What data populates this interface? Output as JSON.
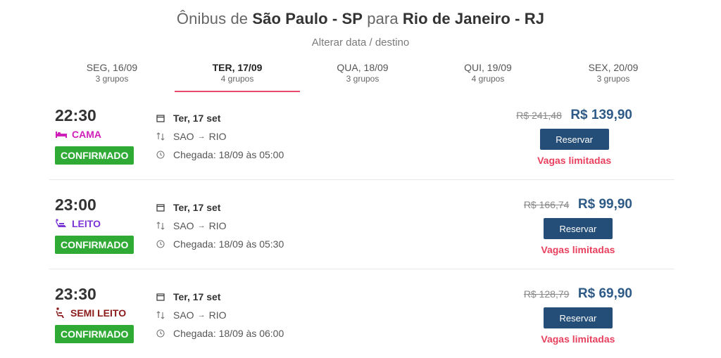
{
  "header": {
    "prefix": "Ônibus de",
    "origin": "São Paulo - SP",
    "middle": "para",
    "destination": "Rio de Janeiro - RJ",
    "change_link": "Alterar data / destino"
  },
  "tabs": [
    {
      "date": "SEG, 16/09",
      "groups": "3 grupos",
      "active": false
    },
    {
      "date": "TER, 17/09",
      "groups": "4 grupos",
      "active": true
    },
    {
      "date": "QUA, 18/09",
      "groups": "3 grupos",
      "active": false
    },
    {
      "date": "QUI, 19/09",
      "groups": "4 grupos",
      "active": false
    },
    {
      "date": "SEX, 20/09",
      "groups": "3 grupos",
      "active": false
    }
  ],
  "results": [
    {
      "time": "22:30",
      "seat_type": "CAMA",
      "seat_color": "#d01fb9",
      "seat_icon": "bed-icon",
      "status": "CONFIRMADO",
      "date": "Ter, 17 set",
      "from": "SAO",
      "to": "RIO",
      "arrival": "Chegada: 18/09 às 05:00",
      "old_price": "R$ 241,48",
      "price": "R$ 139,90",
      "reserve_label": "Reservar",
      "availability": "Vagas limitadas"
    },
    {
      "time": "23:00",
      "seat_type": "LEITO",
      "seat_color": "#7b35d6",
      "seat_icon": "recliner-icon",
      "status": "CONFIRMADO",
      "date": "Ter, 17 set",
      "from": "SAO",
      "to": "RIO",
      "arrival": "Chegada: 18/09 às 05:30",
      "old_price": "R$ 166,74",
      "price": "R$ 99,90",
      "reserve_label": "Reservar",
      "availability": "Vagas limitadas"
    },
    {
      "time": "23:30",
      "seat_type": "SEMI LEITO",
      "seat_color": "#8b1a1a",
      "seat_icon": "seat-icon",
      "status": "CONFIRMADO",
      "date": "Ter, 17 set",
      "from": "SAO",
      "to": "RIO",
      "arrival": "Chegada: 18/09 às 06:00",
      "old_price": "R$ 128,79",
      "price": "R$ 69,90",
      "reserve_label": "Reservar",
      "availability": "Vagas limitadas"
    }
  ]
}
